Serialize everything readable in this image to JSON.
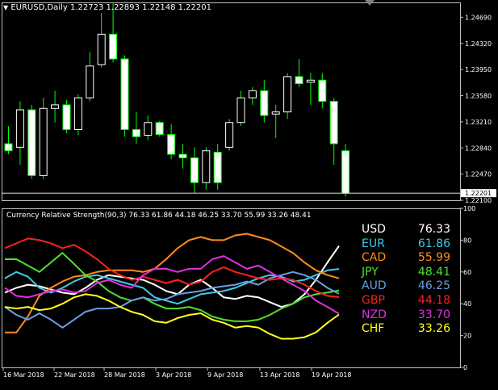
{
  "main_chart": {
    "symbol": "EURUSD",
    "timeframe": "Daily",
    "ohlc": [
      "1.22723",
      "1.22893",
      "1.22148",
      "1.22201"
    ],
    "price_ticks": [
      "1.24690",
      "1.24320",
      "1.23950",
      "1.23580",
      "1.23210",
      "1.22840",
      "1.22470",
      "1.22100"
    ],
    "current_price": "1.22201",
    "colors": {
      "bull": "#ffffff",
      "bear": "#ffffff",
      "wick": "#00ff00",
      "grid": "#c0c0c0",
      "price_line": "#ffffff"
    }
  },
  "chart_data": [
    {
      "type": "candlestick",
      "title": "EURUSD,Daily",
      "ylim": [
        1.221,
        1.249
      ],
      "candles": [
        {
          "o": 1.229,
          "h": 1.2315,
          "l": 1.2275,
          "c": 1.228
        },
        {
          "o": 1.2285,
          "h": 1.235,
          "l": 1.226,
          "c": 1.2338
        },
        {
          "o": 1.2338,
          "h": 1.2345,
          "l": 1.224,
          "c": 1.2245
        },
        {
          "o": 1.2245,
          "h": 1.2355,
          "l": 1.224,
          "c": 1.234
        },
        {
          "o": 1.234,
          "h": 1.2365,
          "l": 1.232,
          "c": 1.2345
        },
        {
          "o": 1.2345,
          "h": 1.2352,
          "l": 1.2305,
          "c": 1.231
        },
        {
          "o": 1.231,
          "h": 1.236,
          "l": 1.2302,
          "c": 1.2355
        },
        {
          "o": 1.2355,
          "h": 1.242,
          "l": 1.235,
          "c": 1.24
        },
        {
          "o": 1.2402,
          "h": 1.2475,
          "l": 1.2398,
          "c": 1.2445
        },
        {
          "o": 1.2445,
          "h": 1.249,
          "l": 1.2405,
          "c": 1.241
        },
        {
          "o": 1.241,
          "h": 1.2415,
          "l": 1.23,
          "c": 1.231
        },
        {
          "o": 1.231,
          "h": 1.2335,
          "l": 1.229,
          "c": 1.23
        },
        {
          "o": 1.2302,
          "h": 1.233,
          "l": 1.2295,
          "c": 1.232
        },
        {
          "o": 1.232,
          "h": 1.2322,
          "l": 1.23,
          "c": 1.2303
        },
        {
          "o": 1.2303,
          "h": 1.2318,
          "l": 1.2268,
          "c": 1.2275
        },
        {
          "o": 1.2275,
          "h": 1.229,
          "l": 1.2255,
          "c": 1.227
        },
        {
          "o": 1.227,
          "h": 1.2285,
          "l": 1.222,
          "c": 1.2235
        },
        {
          "o": 1.2235,
          "h": 1.2285,
          "l": 1.2225,
          "c": 1.228
        },
        {
          "o": 1.2278,
          "h": 1.229,
          "l": 1.2225,
          "c": 1.2235
        },
        {
          "o": 1.2285,
          "h": 1.2325,
          "l": 1.228,
          "c": 1.232
        },
        {
          "o": 1.232,
          "h": 1.2365,
          "l": 1.2315,
          "c": 1.2355
        },
        {
          "o": 1.2355,
          "h": 1.237,
          "l": 1.2345,
          "c": 1.2365
        },
        {
          "o": 1.2365,
          "h": 1.238,
          "l": 1.232,
          "c": 1.233
        },
        {
          "o": 1.2332,
          "h": 1.2345,
          "l": 1.2298,
          "c": 1.2335
        },
        {
          "o": 1.2335,
          "h": 1.239,
          "l": 1.2325,
          "c": 1.2385
        },
        {
          "o": 1.2385,
          "h": 1.241,
          "l": 1.237,
          "c": 1.2375
        },
        {
          "o": 1.2377,
          "h": 1.239,
          "l": 1.2345,
          "c": 1.238
        },
        {
          "o": 1.238,
          "h": 1.239,
          "l": 1.234,
          "c": 1.235
        },
        {
          "o": 1.235,
          "h": 1.2355,
          "l": 1.226,
          "c": 1.229
        },
        {
          "o": 1.228,
          "h": 1.229,
          "l": 1.2215,
          "c": 1.222
        }
      ]
    },
    {
      "type": "line",
      "title": "Currency Relative Strength(90,3) 76.33 61.86 44.18 46.25 33.70 55.99 33.26 48.41",
      "ylim": [
        0,
        100
      ],
      "y_ticks": [
        "0",
        "20",
        "40",
        "60",
        "80",
        "100"
      ],
      "x_labels": [
        "16 Mar 2018",
        "22 Mar 2018",
        "28 Mar 2018",
        "3 Apr 2018",
        "9 Apr 2018",
        "13 Apr 2018",
        "19 Apr 2018"
      ],
      "series": [
        {
          "name": "USD",
          "color": "#ffffff",
          "values": [
            47,
            50,
            52,
            51,
            49,
            47,
            46,
            50,
            55,
            58,
            57,
            56,
            55,
            52,
            48,
            46,
            52,
            55,
            50,
            44,
            43,
            45,
            44,
            41,
            38,
            40,
            46,
            55,
            66,
            76.33
          ]
        },
        {
          "name": "EUR",
          "color": "#3fc9e8",
          "values": [
            56,
            60,
            57,
            50,
            47,
            50,
            54,
            57,
            58,
            56,
            54,
            52,
            50,
            44,
            42,
            40,
            43,
            46,
            47,
            48,
            50,
            53,
            56,
            58,
            57,
            54,
            55,
            58,
            61,
            61.86
          ]
        },
        {
          "name": "CAD",
          "color": "#ff8c1a",
          "values": [
            22,
            22,
            32,
            45,
            50,
            54,
            57,
            58,
            60,
            61,
            61,
            61,
            60,
            62,
            68,
            75,
            80,
            82,
            80,
            80,
            83,
            84,
            82,
            80,
            76,
            72,
            66,
            61,
            58,
            55.99
          ]
        },
        {
          "name": "JPY",
          "color": "#4ee02e",
          "values": [
            68,
            68,
            64,
            60,
            66,
            72,
            65,
            58,
            54,
            48,
            44,
            42,
            44,
            40,
            37,
            37,
            38,
            36,
            32,
            30,
            29,
            29,
            30,
            33,
            37,
            40,
            44,
            46,
            47,
            48.41
          ]
        },
        {
          "name": "AUD",
          "color": "#6b9ee0",
          "values": [
            38,
            33,
            30,
            34,
            30,
            25,
            30,
            35,
            37,
            37,
            38,
            42,
            44,
            42,
            43,
            46,
            47,
            48,
            50,
            51,
            52,
            54,
            52,
            56,
            58,
            60,
            58,
            55,
            50,
            46.25
          ]
        },
        {
          "name": "GBP",
          "color": "#ff2020",
          "values": [
            75,
            78,
            81,
            80,
            78,
            75,
            77,
            73,
            68,
            62,
            58,
            55,
            57,
            55,
            53,
            55,
            52,
            54,
            60,
            63,
            60,
            58,
            56,
            55,
            56,
            55,
            52,
            48,
            45,
            44.18
          ]
        },
        {
          "name": "NZD",
          "color": "#e030e0",
          "values": [
            50,
            45,
            44,
            46,
            48,
            49,
            47,
            48,
            53,
            55,
            52,
            50,
            58,
            62,
            62,
            60,
            62,
            62,
            68,
            70,
            66,
            62,
            64,
            60,
            56,
            52,
            48,
            42,
            38,
            33.7
          ]
        },
        {
          "name": "CHF",
          "color": "#ffff20",
          "values": [
            38,
            37,
            38,
            36,
            37,
            40,
            44,
            46,
            45,
            42,
            38,
            35,
            33,
            29,
            28,
            31,
            33,
            34,
            30,
            28,
            25,
            26,
            25,
            21,
            18,
            18,
            19,
            22,
            28,
            33.26
          ]
        }
      ]
    }
  ]
}
